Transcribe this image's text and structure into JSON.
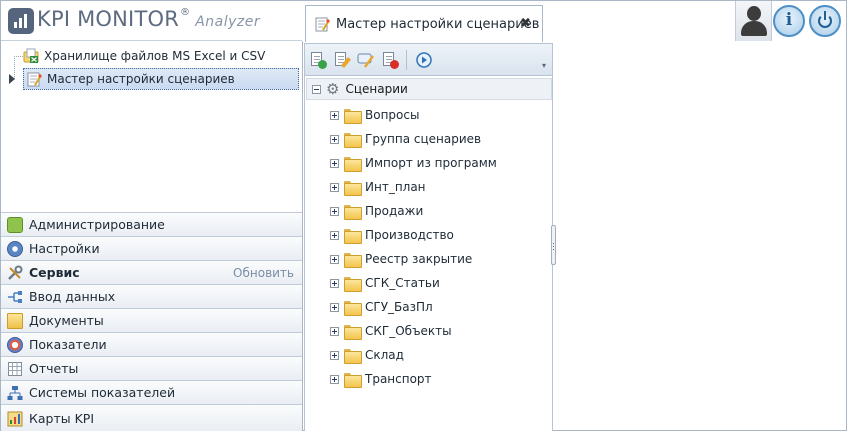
{
  "app": {
    "logo_text": "KPI MONITOR",
    "logo_registered": "®",
    "logo_sub": "Analyzer"
  },
  "nav_tree": {
    "items": [
      {
        "label": "Хранилище файлов MS Excel и CSV",
        "icon": "excel-storage-icon"
      },
      {
        "label": "Мастер настройки сценариев",
        "icon": "wizard-icon",
        "selected": true
      }
    ]
  },
  "sections": [
    {
      "label": "Администрирование",
      "icon": "cube-icon",
      "color": "#8fc34b"
    },
    {
      "label": "Настройки",
      "icon": "settings-icon",
      "color": "#5a86c5"
    },
    {
      "label": "Сервис",
      "icon": "tools-icon",
      "color": "#7a8796",
      "active": true,
      "action": "Обновить"
    },
    {
      "label": "Ввод данных",
      "icon": "data-entry-icon",
      "color": "#4a7fc0"
    },
    {
      "label": "Документы",
      "icon": "documents-icon",
      "color": "#f0c04a"
    },
    {
      "label": "Показатели",
      "icon": "indicators-icon",
      "color": "#6a7fc0"
    },
    {
      "label": "Отчеты",
      "icon": "reports-icon",
      "color": "#7f8c9a"
    },
    {
      "label": "Системы показателей",
      "icon": "hierarchy-icon",
      "color": "#3d6fb3"
    },
    {
      "label": "Карты KPI",
      "icon": "kpi-map-icon",
      "color": "#d8b04a"
    }
  ],
  "tab": {
    "label": "Мастер настройки сценариев",
    "close": "✖"
  },
  "topbar": {
    "info_glyph": "i"
  },
  "toolbar": {
    "buttons": [
      "add-scenario",
      "edit-scenario",
      "rename-scenario",
      "delete-scenario",
      "run-scenario"
    ],
    "more": "▾"
  },
  "scenario_tree": {
    "root": "Сценарии",
    "children": [
      "Вопросы",
      "Группа сценариев",
      "Импорт из программ",
      "Инт_план",
      "Продажи",
      "Производство",
      "Реестр закрытие",
      "СГК_Статьи",
      "СГУ_БазПл",
      "СКГ_Объекты",
      "Склад",
      "Транспорт"
    ]
  }
}
